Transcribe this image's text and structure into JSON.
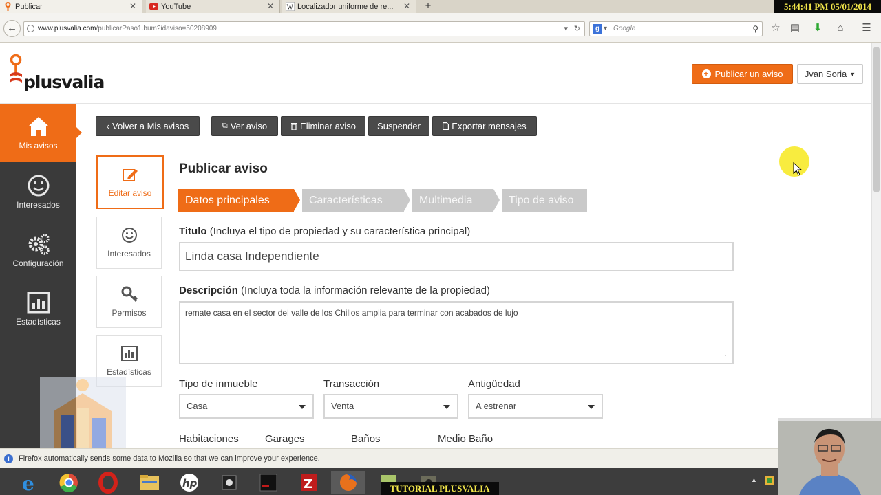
{
  "browser": {
    "tabs": [
      {
        "label": "Publicar",
        "close": "✕"
      },
      {
        "label": "YouTube",
        "close": "✕"
      },
      {
        "label": "Localizador uniforme de re...",
        "close": "✕"
      }
    ],
    "new_tab": "+",
    "clock": "5:44:41 PM 05/01/2014",
    "url_domain": "www.plusvalia.com",
    "url_path": "/publicarPaso1.bum?idaviso=50208909",
    "search_placeholder": "Google",
    "search_engine_letter": "g"
  },
  "header": {
    "logo_text": "plusvalia",
    "publish_button": "Publicar un aviso",
    "user_name": "Jvan Soria"
  },
  "sidebar": {
    "items": [
      {
        "label": "Mis avisos",
        "icon": "home-icon"
      },
      {
        "label": "Interesados",
        "icon": "smiley-icon"
      },
      {
        "label": "Configuración",
        "icon": "gears-icon"
      },
      {
        "label": "Estadísticas",
        "icon": "bar-chart-icon"
      }
    ]
  },
  "toolbar": {
    "back": "Volver a Mis avisos",
    "view": "Ver aviso",
    "delete": "Eliminar aviso",
    "suspend": "Suspender",
    "export": "Exportar mensajes"
  },
  "subnav": {
    "items": [
      {
        "label": "Editar aviso"
      },
      {
        "label": "Interesados"
      },
      {
        "label": "Permisos"
      },
      {
        "label": "Estadísticas"
      }
    ]
  },
  "form": {
    "title": "Publicar aviso",
    "steps": [
      "Datos principales",
      "Características",
      "Multimedia",
      "Tipo de aviso"
    ],
    "titulo_label": "Titulo",
    "titulo_hint": "(Incluya el tipo de propiedad y su característica principal)",
    "titulo_value": "Linda casa Independiente",
    "descripcion_label": "Descripción",
    "descripcion_hint": "(Incluya toda la información relevante de la propiedad)",
    "descripcion_value": "remate casa en el sector del valle de los Chillos amplia para terminar con acabados de lujo",
    "tipo_label": "Tipo de inmueble",
    "tipo_value": "Casa",
    "transaccion_label": "Transacción",
    "transaccion_value": "Venta",
    "antiguedad_label": "Antigüedad",
    "antiguedad_value": "A estrenar",
    "habitaciones_label": "Habitaciones",
    "garages_label": "Garages",
    "banos_label": "Baños",
    "medio_bano_label": "Medio Baño"
  },
  "notification": "Firefox automatically sends some data to Mozilla so that we can improve your experience.",
  "taskbar": {
    "tutorial_label": "TUTORIAL PLUSVALIA"
  },
  "colors": {
    "accent": "#ef6c17",
    "sidebar_bg": "#3a3a3a",
    "step_inactive": "#c9c9c9"
  }
}
